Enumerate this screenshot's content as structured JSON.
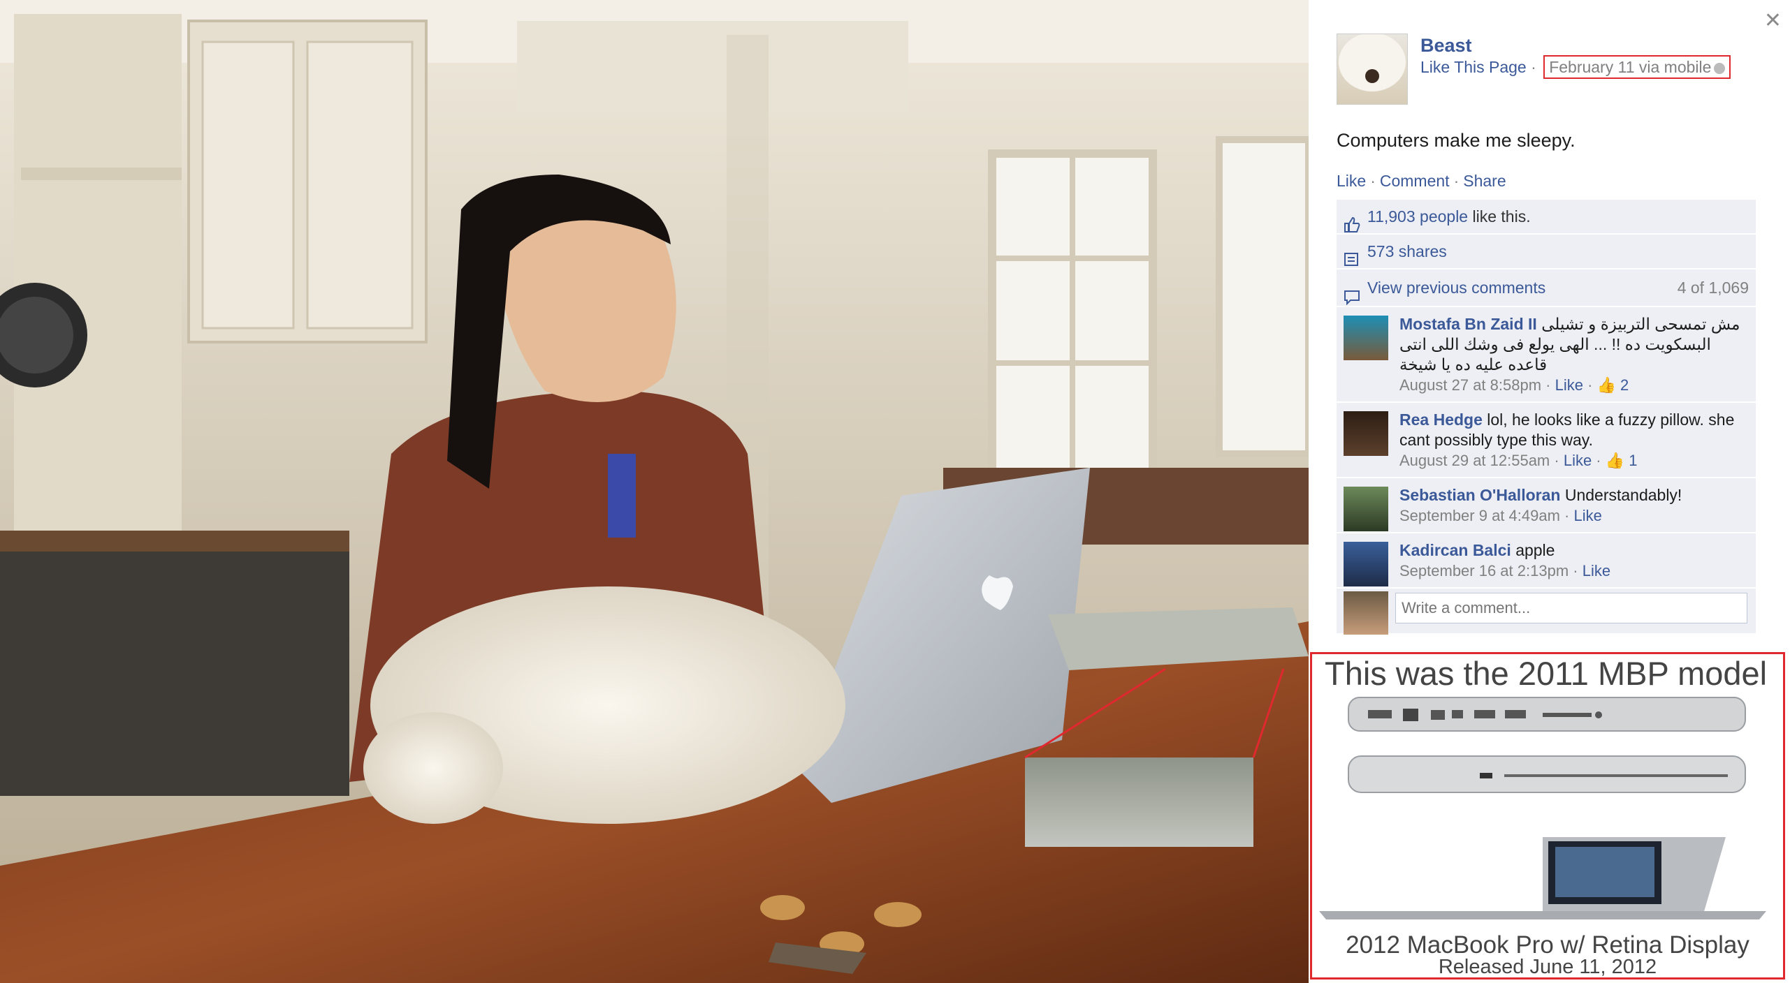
{
  "post": {
    "page_name": "Beast",
    "like_page": "Like This Page",
    "separator": "·",
    "date": "February 11 via mobile",
    "text": "Computers make me sleepy.",
    "actions": [
      "Like",
      "Comment",
      "Share"
    ]
  },
  "ufi": {
    "likes_link": "11,903 people",
    "likes_suffix": " like this.",
    "shares": "573 shares",
    "view_previous": "View previous comments",
    "comment_count": "4 of 1,069",
    "comments": [
      {
        "name": "Mostafa Bn Zaid II",
        "text": "مش تمسحى التربيزة و تشيلى البسكويت ده !! ... الهى يولع فى وشك اللى انتى قاعده عليه ده يا شيخة",
        "time": "August 27 at 8:58pm",
        "like": "Like",
        "likes": "2"
      },
      {
        "name": "Rea Hedge",
        "text": "lol, he looks like a fuzzy pillow. she cant possibly type this way.",
        "time": "August 29 at 12:55am",
        "like": "Like",
        "likes": "1"
      },
      {
        "name": "Sebastian O'Halloran",
        "text": "Understandably!",
        "time": "September 9 at 4:49am",
        "like": "Like",
        "likes": ""
      },
      {
        "name": "Kadircan Balci",
        "text": "apple",
        "time": "September 16 at 2:13pm",
        "like": "Like",
        "likes": ""
      }
    ],
    "write_placeholder": "Write a comment..."
  },
  "annotation": {
    "title": "This was the 2011 MBP model",
    "subtitle1": "2012 MacBook Pro w/ Retina Display",
    "subtitle2": "Released June 11, 2012"
  },
  "colors": {
    "link": "#3b5998",
    "highlight": "#e0292f",
    "ufi_bg": "#edeff4"
  }
}
